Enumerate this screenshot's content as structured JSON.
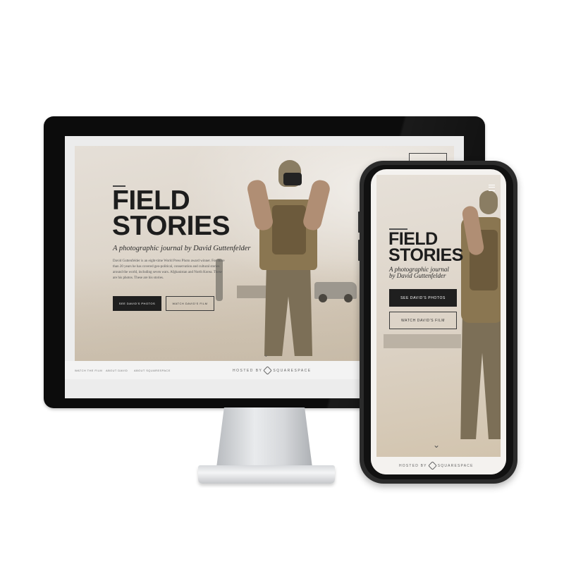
{
  "site": {
    "title_line1": "FIELD",
    "title_line2": "STORIES",
    "subtitle": "A photographic journal by David Guttenfelder",
    "phone_subtitle_line1": "A photographic journal",
    "phone_subtitle_line2": "by David Guttenfelder",
    "body": "David Guttenfelder is an eight-time World Press Photo award winner. For more than 20 years he has covered geo-political, conservation and cultural stories around the world, including seven wars. Afghanistan and North Korea. These are his photos. These are his stories.",
    "buttons": {
      "photos_desktop": "SEE DAVID'S PHOTOS",
      "film_desktop": "WATCH DAVID'S FILM",
      "photos_phone": "SEE DAVID'S PHOTOS",
      "film_phone": "WATCH DAVID'S FILM"
    },
    "footer_links": [
      "WATCH THE FILM",
      "ABOUT DAVID",
      "ABOUT SQUARESPACE"
    ],
    "hosted_by": "HOSTED BY",
    "brand": "SQUARESPACE"
  },
  "icons": {
    "scroll_down": "chevron-down-icon",
    "menu": "hamburger-menu-icon",
    "brand_logo": "squarespace-logo-icon"
  },
  "colors": {
    "button_dark": "#1f1f1f",
    "hero_background": "#e0d8cc",
    "monitor_bezel": "#0c0c0c",
    "phone_frame": "#2b2b2b"
  }
}
